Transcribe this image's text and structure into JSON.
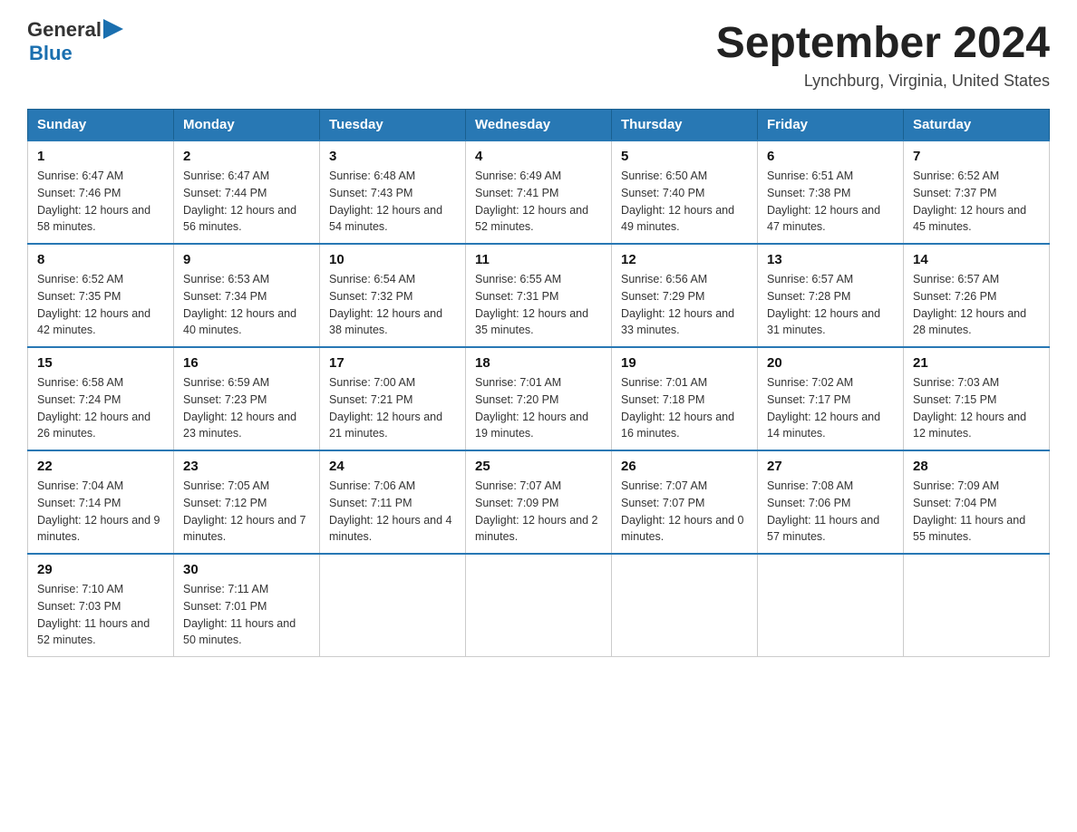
{
  "header": {
    "logo_general": "General",
    "logo_blue": "Blue",
    "title": "September 2024",
    "subtitle": "Lynchburg, Virginia, United States"
  },
  "days_of_week": [
    "Sunday",
    "Monday",
    "Tuesday",
    "Wednesday",
    "Thursday",
    "Friday",
    "Saturday"
  ],
  "weeks": [
    [
      {
        "date": "1",
        "sunrise": "Sunrise: 6:47 AM",
        "sunset": "Sunset: 7:46 PM",
        "daylight": "Daylight: 12 hours and 58 minutes."
      },
      {
        "date": "2",
        "sunrise": "Sunrise: 6:47 AM",
        "sunset": "Sunset: 7:44 PM",
        "daylight": "Daylight: 12 hours and 56 minutes."
      },
      {
        "date": "3",
        "sunrise": "Sunrise: 6:48 AM",
        "sunset": "Sunset: 7:43 PM",
        "daylight": "Daylight: 12 hours and 54 minutes."
      },
      {
        "date": "4",
        "sunrise": "Sunrise: 6:49 AM",
        "sunset": "Sunset: 7:41 PM",
        "daylight": "Daylight: 12 hours and 52 minutes."
      },
      {
        "date": "5",
        "sunrise": "Sunrise: 6:50 AM",
        "sunset": "Sunset: 7:40 PM",
        "daylight": "Daylight: 12 hours and 49 minutes."
      },
      {
        "date": "6",
        "sunrise": "Sunrise: 6:51 AM",
        "sunset": "Sunset: 7:38 PM",
        "daylight": "Daylight: 12 hours and 47 minutes."
      },
      {
        "date": "7",
        "sunrise": "Sunrise: 6:52 AM",
        "sunset": "Sunset: 7:37 PM",
        "daylight": "Daylight: 12 hours and 45 minutes."
      }
    ],
    [
      {
        "date": "8",
        "sunrise": "Sunrise: 6:52 AM",
        "sunset": "Sunset: 7:35 PM",
        "daylight": "Daylight: 12 hours and 42 minutes."
      },
      {
        "date": "9",
        "sunrise": "Sunrise: 6:53 AM",
        "sunset": "Sunset: 7:34 PM",
        "daylight": "Daylight: 12 hours and 40 minutes."
      },
      {
        "date": "10",
        "sunrise": "Sunrise: 6:54 AM",
        "sunset": "Sunset: 7:32 PM",
        "daylight": "Daylight: 12 hours and 38 minutes."
      },
      {
        "date": "11",
        "sunrise": "Sunrise: 6:55 AM",
        "sunset": "Sunset: 7:31 PM",
        "daylight": "Daylight: 12 hours and 35 minutes."
      },
      {
        "date": "12",
        "sunrise": "Sunrise: 6:56 AM",
        "sunset": "Sunset: 7:29 PM",
        "daylight": "Daylight: 12 hours and 33 minutes."
      },
      {
        "date": "13",
        "sunrise": "Sunrise: 6:57 AM",
        "sunset": "Sunset: 7:28 PM",
        "daylight": "Daylight: 12 hours and 31 minutes."
      },
      {
        "date": "14",
        "sunrise": "Sunrise: 6:57 AM",
        "sunset": "Sunset: 7:26 PM",
        "daylight": "Daylight: 12 hours and 28 minutes."
      }
    ],
    [
      {
        "date": "15",
        "sunrise": "Sunrise: 6:58 AM",
        "sunset": "Sunset: 7:24 PM",
        "daylight": "Daylight: 12 hours and 26 minutes."
      },
      {
        "date": "16",
        "sunrise": "Sunrise: 6:59 AM",
        "sunset": "Sunset: 7:23 PM",
        "daylight": "Daylight: 12 hours and 23 minutes."
      },
      {
        "date": "17",
        "sunrise": "Sunrise: 7:00 AM",
        "sunset": "Sunset: 7:21 PM",
        "daylight": "Daylight: 12 hours and 21 minutes."
      },
      {
        "date": "18",
        "sunrise": "Sunrise: 7:01 AM",
        "sunset": "Sunset: 7:20 PM",
        "daylight": "Daylight: 12 hours and 19 minutes."
      },
      {
        "date": "19",
        "sunrise": "Sunrise: 7:01 AM",
        "sunset": "Sunset: 7:18 PM",
        "daylight": "Daylight: 12 hours and 16 minutes."
      },
      {
        "date": "20",
        "sunrise": "Sunrise: 7:02 AM",
        "sunset": "Sunset: 7:17 PM",
        "daylight": "Daylight: 12 hours and 14 minutes."
      },
      {
        "date": "21",
        "sunrise": "Sunrise: 7:03 AM",
        "sunset": "Sunset: 7:15 PM",
        "daylight": "Daylight: 12 hours and 12 minutes."
      }
    ],
    [
      {
        "date": "22",
        "sunrise": "Sunrise: 7:04 AM",
        "sunset": "Sunset: 7:14 PM",
        "daylight": "Daylight: 12 hours and 9 minutes."
      },
      {
        "date": "23",
        "sunrise": "Sunrise: 7:05 AM",
        "sunset": "Sunset: 7:12 PM",
        "daylight": "Daylight: 12 hours and 7 minutes."
      },
      {
        "date": "24",
        "sunrise": "Sunrise: 7:06 AM",
        "sunset": "Sunset: 7:11 PM",
        "daylight": "Daylight: 12 hours and 4 minutes."
      },
      {
        "date": "25",
        "sunrise": "Sunrise: 7:07 AM",
        "sunset": "Sunset: 7:09 PM",
        "daylight": "Daylight: 12 hours and 2 minutes."
      },
      {
        "date": "26",
        "sunrise": "Sunrise: 7:07 AM",
        "sunset": "Sunset: 7:07 PM",
        "daylight": "Daylight: 12 hours and 0 minutes."
      },
      {
        "date": "27",
        "sunrise": "Sunrise: 7:08 AM",
        "sunset": "Sunset: 7:06 PM",
        "daylight": "Daylight: 11 hours and 57 minutes."
      },
      {
        "date": "28",
        "sunrise": "Sunrise: 7:09 AM",
        "sunset": "Sunset: 7:04 PM",
        "daylight": "Daylight: 11 hours and 55 minutes."
      }
    ],
    [
      {
        "date": "29",
        "sunrise": "Sunrise: 7:10 AM",
        "sunset": "Sunset: 7:03 PM",
        "daylight": "Daylight: 11 hours and 52 minutes."
      },
      {
        "date": "30",
        "sunrise": "Sunrise: 7:11 AM",
        "sunset": "Sunset: 7:01 PM",
        "daylight": "Daylight: 11 hours and 50 minutes."
      },
      null,
      null,
      null,
      null,
      null
    ]
  ]
}
